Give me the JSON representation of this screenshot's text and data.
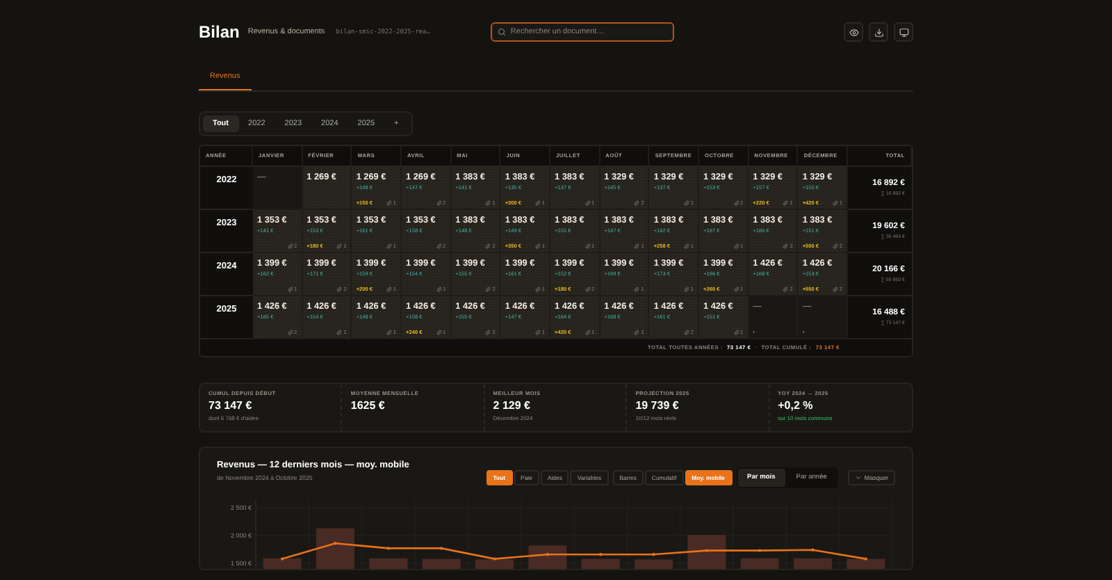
{
  "header": {
    "title": "Bilan",
    "subtitle": "Revenus & documents",
    "file": "bilan-smic-2022-2025-rea…",
    "search": {
      "placeholder": "Rechercher un document…"
    }
  },
  "tabs": [
    {
      "label": "Revenus",
      "selected": true
    }
  ],
  "year_filter": [
    {
      "label": "Tout",
      "selected": true
    },
    {
      "label": "2022",
      "selected": false
    },
    {
      "label": "2023",
      "selected": false
    },
    {
      "label": "2024",
      "selected": false
    },
    {
      "label": "2025",
      "selected": false
    },
    {
      "label": "+",
      "selected": false
    }
  ],
  "table": {
    "columns": [
      "ANNÉE",
      "JANVIER",
      "FÉVRIER",
      "MARS",
      "AVRIL",
      "MAI",
      "JUIN",
      "JUILLET",
      "AOÛT",
      "SEPTEMBRE",
      "OCTOBRE",
      "NOVEMBRE",
      "DÉCEMBRE",
      "TOTAL"
    ],
    "rows": [
      {
        "cells": [
          {
            "kind": "year",
            "amount": "2022"
          },
          {
            "kind": "empty",
            "amount": "—"
          },
          {
            "kind": "filled",
            "amount": "1 269 €"
          },
          {
            "kind": "filled",
            "amount": "1 269 €",
            "plus": "+148 €",
            "bonus": "+150 €",
            "attachments": "1"
          },
          {
            "kind": "filled",
            "amount": "1 269 €",
            "plus": "+147 €",
            "attachments": "2"
          },
          {
            "kind": "filled",
            "amount": "1 383 €",
            "plus": "+141 €",
            "attachments": "1"
          },
          {
            "kind": "filled",
            "amount": "1 383 €",
            "plus": "+135 €",
            "bonus": "+300 €",
            "attachments": "1"
          },
          {
            "kind": "filled",
            "amount": "1 383 €",
            "plus": "+137 €",
            "attachments": "1"
          },
          {
            "kind": "filled",
            "amount": "1 329 €",
            "plus": "+145 €",
            "attachments": "2"
          },
          {
            "kind": "filled",
            "amount": "1 329 €",
            "plus": "+137 €",
            "attachments": "1"
          },
          {
            "kind": "filled",
            "amount": "1 329 €",
            "plus": "+153 €",
            "attachments": "2"
          },
          {
            "kind": "filled",
            "amount": "1 329 €",
            "plus": "+157 €",
            "bonus": "+220 €",
            "attachments": "1"
          },
          {
            "kind": "filled",
            "amount": "1 329 €",
            "plus": "+150 €",
            "bonus": "+420 €",
            "attachments": "1"
          },
          {
            "kind": "total",
            "amount": "16 892 €",
            "cumulative": "∑ 16 892 €"
          }
        ]
      },
      {
        "cells": [
          {
            "kind": "year",
            "amount": "2023"
          },
          {
            "kind": "filled",
            "amount": "1 353 €",
            "plus": "+141 €",
            "attachments": "2"
          },
          {
            "kind": "filled",
            "amount": "1 353 €",
            "plus": "+153 €",
            "bonus": "+180 €",
            "attachments": "1"
          },
          {
            "kind": "filled",
            "amount": "1 353 €",
            "plus": "+161 €",
            "attachments": "1"
          },
          {
            "kind": "filled",
            "amount": "1 353 €",
            "plus": "+158 €",
            "attachments": "2"
          },
          {
            "kind": "filled",
            "amount": "1 383 €",
            "plus": "+148 €",
            "attachments": "2"
          },
          {
            "kind": "filled",
            "amount": "1 383 €",
            "plus": "+149 €",
            "bonus": "+350 €",
            "attachments": "1"
          },
          {
            "kind": "filled",
            "amount": "1 383 €",
            "plus": "+155 €",
            "attachments": "1"
          },
          {
            "kind": "filled",
            "amount": "1 383 €",
            "plus": "+147 €",
            "attachments": "1"
          },
          {
            "kind": "filled",
            "amount": "1 383 €",
            "plus": "+162 €",
            "bonus": "+258 €",
            "attachments": "1"
          },
          {
            "kind": "filled",
            "amount": "1 383 €",
            "plus": "+167 €",
            "attachments": "1"
          },
          {
            "kind": "filled",
            "amount": "1 383 €",
            "plus": "+160 €",
            "attachments": "2"
          },
          {
            "kind": "filled",
            "amount": "1 383 €",
            "plus": "+151 €",
            "bonus": "+500 €",
            "attachments": "2"
          },
          {
            "kind": "total",
            "amount": "19 602 €",
            "cumulative": "∑ 36 494 €"
          }
        ]
      },
      {
        "cells": [
          {
            "kind": "year",
            "amount": "2024"
          },
          {
            "kind": "filled",
            "amount": "1 399 €",
            "plus": "+162 €",
            "attachments": "1"
          },
          {
            "kind": "filled",
            "amount": "1 399 €",
            "plus": "+171 €",
            "attachments": "2"
          },
          {
            "kind": "filled",
            "amount": "1 399 €",
            "plus": "+159 €",
            "bonus": "+200 €",
            "attachments": "1"
          },
          {
            "kind": "filled",
            "amount": "1 399 €",
            "plus": "+154 €",
            "attachments": "1"
          },
          {
            "kind": "filled",
            "amount": "1 399 €",
            "plus": "+155 €",
            "attachments": "2"
          },
          {
            "kind": "filled",
            "amount": "1 399 €",
            "plus": "+161 €",
            "attachments": "1"
          },
          {
            "kind": "filled",
            "amount": "1 399 €",
            "plus": "+152 €",
            "bonus": "+180 €",
            "attachments": "2"
          },
          {
            "kind": "filled",
            "amount": "1 399 €",
            "plus": "+169 €",
            "attachments": "1"
          },
          {
            "kind": "filled",
            "amount": "1 399 €",
            "plus": "+173 €",
            "attachments": "1"
          },
          {
            "kind": "filled",
            "amount": "1 399 €",
            "plus": "+166 €",
            "bonus": "+260 €",
            "attachments": "1"
          },
          {
            "kind": "filled",
            "amount": "1 426 €",
            "plus": "+168 €",
            "attachments": "2"
          },
          {
            "kind": "filled",
            "amount": "1 426 €",
            "plus": "+153 €",
            "bonus": "+550 €",
            "attachments": "2"
          },
          {
            "kind": "total",
            "amount": "20 166 €",
            "cumulative": "∑ 56 660 €"
          }
        ]
      },
      {
        "cells": [
          {
            "kind": "year",
            "amount": "2025"
          },
          {
            "kind": "filled",
            "amount": "1 426 €",
            "plus": "+165 €",
            "attachments": "2"
          },
          {
            "kind": "filled",
            "amount": "1 426 €",
            "plus": "+154 €",
            "attachments": "1"
          },
          {
            "kind": "filled",
            "amount": "1 426 €",
            "plus": "+148 €",
            "attachments": "1"
          },
          {
            "kind": "filled",
            "amount": "1 426 €",
            "plus": "+158 €",
            "bonus": "+240 €",
            "attachments": "1"
          },
          {
            "kind": "filled",
            "amount": "1 426 €",
            "plus": "+155 €",
            "attachments": "2"
          },
          {
            "kind": "filled",
            "amount": "1 426 €",
            "plus": "+147 €",
            "attachments": "1"
          },
          {
            "kind": "filled",
            "amount": "1 426 €",
            "plus": "+164 €",
            "bonus": "+420 €",
            "attachments": "1"
          },
          {
            "kind": "filled",
            "amount": "1 426 €",
            "plus": "+168 €",
            "attachments": "1"
          },
          {
            "kind": "filled",
            "amount": "1 426 €",
            "plus": "+161 €",
            "attachments": "2"
          },
          {
            "kind": "filled",
            "amount": "1 426 €",
            "plus": "+151 €",
            "attachments": "1"
          },
          {
            "kind": "empty",
            "amount": "—",
            "note": "•"
          },
          {
            "kind": "empty",
            "amount": "—",
            "note": "•"
          },
          {
            "kind": "total",
            "amount": "16 488 €",
            "cumulative": "∑ 73 147 €"
          }
        ]
      }
    ],
    "footer": {
      "total_label": "TOTAL TOUTES ANNÉES :",
      "total": "73 147 €",
      "separator": "·",
      "cumulative_label": "TOTAL CUMULÉ :",
      "cumulative": "73 147 €"
    }
  },
  "stats": [
    {
      "label": "CUMUL DEPUIS DÉBUT",
      "value": "73 147 €",
      "note": "dont 6 768 € d'aides",
      "kind": "muted"
    },
    {
      "label": "MOYENNE MENSUELLE",
      "value": "1625 €"
    },
    {
      "label": "MEILLEUR MOIS",
      "value": "2 129 €",
      "note": "Décembre 2024",
      "kind": "muted"
    },
    {
      "label": "PROJECTION 2025",
      "value": "19 739 €",
      "note": "10/12 mois réels",
      "kind": "muted"
    },
    {
      "label": "YOY 2024 → 2025",
      "value": "+0,2 %",
      "note": "sur 10 mois communs",
      "kind": "positive"
    }
  ],
  "chart_panel": {
    "title": "Revenus — 12 derniers mois — moy. mobile",
    "subtitle": "de Novembre 2024 à Octobre 2025",
    "filter_groups": [
      [
        {
          "label": "Tout",
          "selected": true
        },
        {
          "label": "Paie",
          "selected": false
        },
        {
          "label": "Aides",
          "selected": false
        },
        {
          "label": "Variables",
          "selected": false
        }
      ],
      [
        {
          "label": "Barres",
          "selected": false
        },
        {
          "label": "Cumulatif",
          "selected": false
        },
        {
          "label": "Moy. mobile",
          "selected": true
        }
      ],
      [
        {
          "label": "Par mois",
          "selected": true
        },
        {
          "label": "Par année",
          "selected": false
        }
      ]
    ],
    "hide_button": "Masquer",
    "y_axis_labels": [
      "2 500 €",
      "2 000 €",
      "1 500 €"
    ]
  }
}
